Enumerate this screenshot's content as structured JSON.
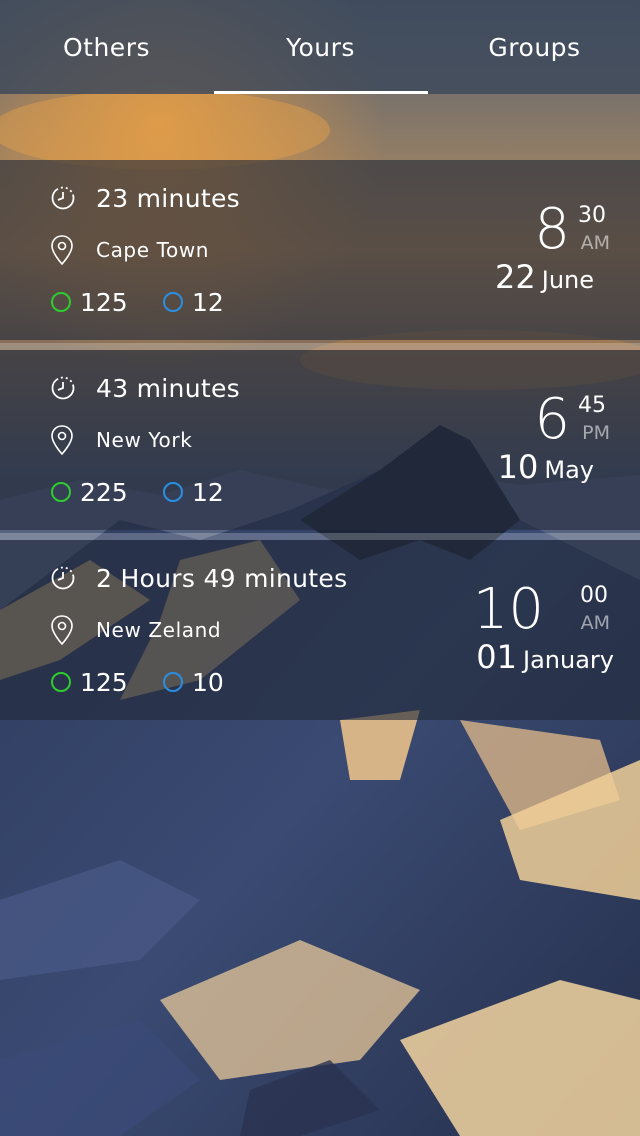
{
  "tabs": [
    {
      "label": "Others",
      "active": false
    },
    {
      "label": "Yours",
      "active": true
    },
    {
      "label": "Groups",
      "active": false
    }
  ],
  "cards": [
    {
      "duration": "23 minutes",
      "location": "Cape Town",
      "green_count": "125",
      "blue_count": "12",
      "hour": "8",
      "minute": "30",
      "ampm": "AM",
      "day": "22",
      "month": "June"
    },
    {
      "duration": "43 minutes",
      "location": "New York",
      "green_count": "225",
      "blue_count": "12",
      "hour": "6",
      "minute": "45",
      "ampm": "PM",
      "day": "10",
      "month": "May"
    },
    {
      "duration": "2 Hours 49 minutes",
      "location": "New Zeland",
      "green_count": "125",
      "blue_count": "10",
      "hour": "10",
      "minute": "00",
      "ampm": "AM",
      "day": "01",
      "month": "January"
    }
  ],
  "colors": {
    "green_status": "#2ecc2e",
    "blue_status": "#2a8fe0",
    "card_background": "#222a3a",
    "tab_background": "#3c485a"
  },
  "icons": {
    "duration": "clock-icon",
    "location": "location-pin-icon",
    "green_count": "green-circle-icon",
    "blue_count": "blue-circle-icon"
  }
}
